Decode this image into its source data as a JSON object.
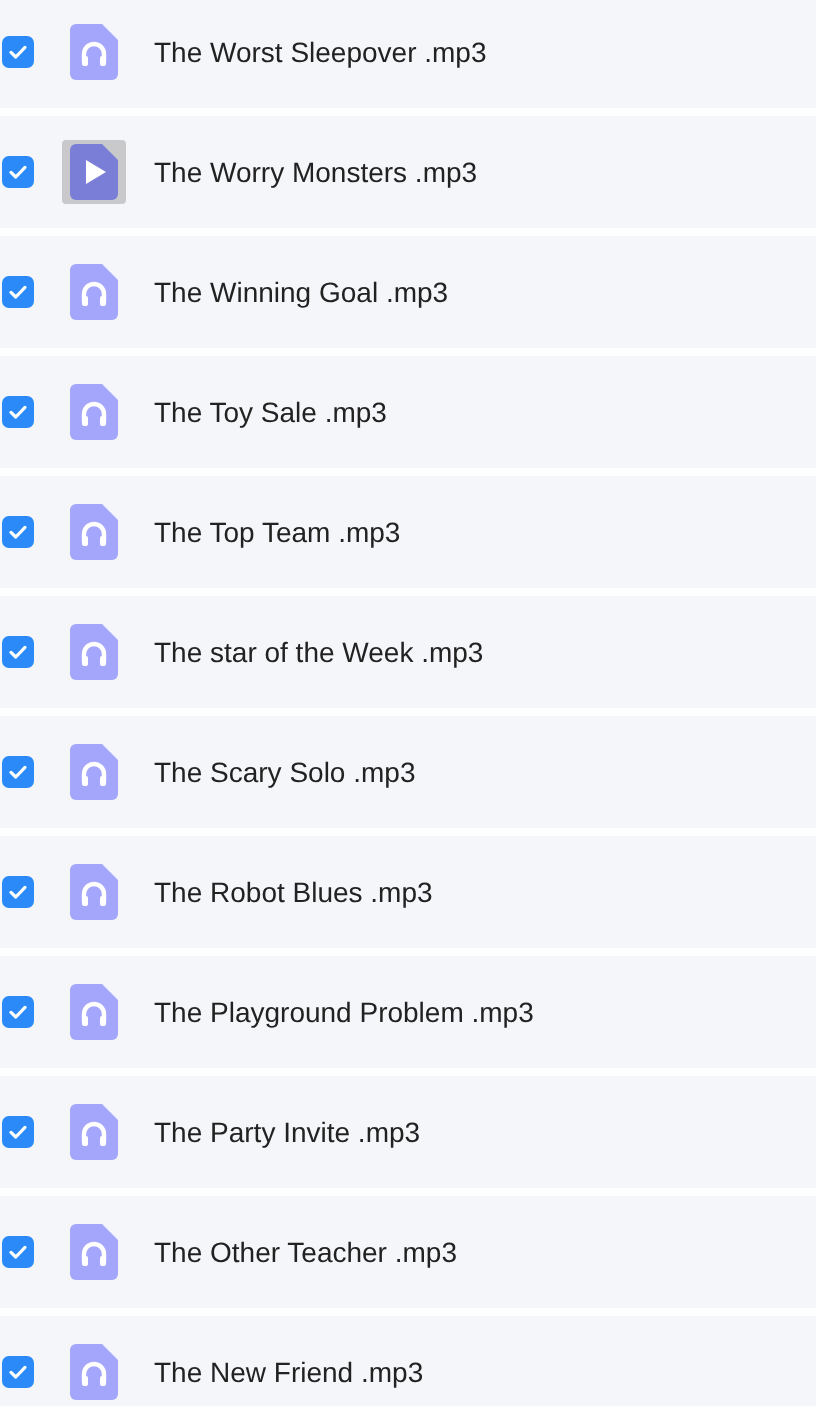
{
  "files": [
    {
      "name": "The Worst Sleepover .mp3",
      "checked": true,
      "kind": "audio"
    },
    {
      "name": "The Worry Monsters .mp3",
      "checked": true,
      "kind": "playing"
    },
    {
      "name": "The Winning Goal .mp3",
      "checked": true,
      "kind": "audio"
    },
    {
      "name": "The Toy Sale .mp3",
      "checked": true,
      "kind": "audio"
    },
    {
      "name": "The Top Team .mp3",
      "checked": true,
      "kind": "audio"
    },
    {
      "name": "The star of the Week .mp3",
      "checked": true,
      "kind": "audio"
    },
    {
      "name": "The Scary Solo .mp3",
      "checked": true,
      "kind": "audio"
    },
    {
      "name": "The Robot Blues .mp3",
      "checked": true,
      "kind": "audio"
    },
    {
      "name": "The Playground Problem .mp3",
      "checked": true,
      "kind": "audio"
    },
    {
      "name": "The Party Invite .mp3",
      "checked": true,
      "kind": "audio"
    },
    {
      "name": "The Other Teacher .mp3",
      "checked": true,
      "kind": "audio"
    },
    {
      "name": "The New Friend .mp3",
      "checked": true,
      "kind": "audio"
    }
  ]
}
